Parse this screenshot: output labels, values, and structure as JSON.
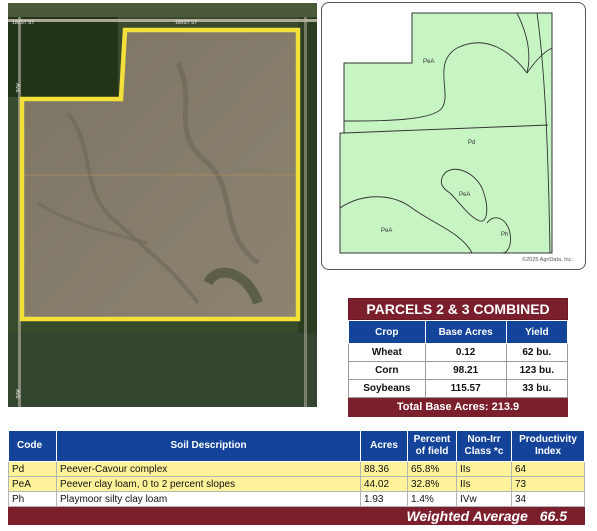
{
  "aerial": {
    "road_labels": [
      "180ST ST",
      "180ST ST",
      "AVE",
      "AVE"
    ]
  },
  "soil_map": {
    "labels": [
      "PeA",
      "Pd",
      "PeA",
      "PeA",
      "Ph"
    ],
    "copyright": "©2025 AgriData, Inc.",
    "colors": {
      "fill": "#c6f4c3",
      "line": "#333333"
    }
  },
  "parcels": {
    "title": "PARCELS 2 & 3 COMBINED",
    "headers": [
      "Crop",
      "Base Acres",
      "Yield"
    ],
    "rows": [
      [
        "Wheat",
        "0.12",
        "62 bu."
      ],
      [
        "Corn",
        "98.21",
        "123 bu."
      ],
      [
        "Soybeans",
        "115.57",
        "33 bu."
      ]
    ],
    "total_label": "Total Base Acres:",
    "total_value": "213.9"
  },
  "soils": {
    "headers": {
      "code": "Code",
      "description": "Soil Description",
      "acres": "Acres",
      "percent": "Percent of field",
      "nonirr": "Non-Irr Class *c",
      "productivity": "Productivity Index"
    },
    "rows": [
      {
        "code": "Pd",
        "description": "Peever-Cavour complex",
        "acres": "88.36",
        "percent": "65.8%",
        "nonirr": "IIs",
        "productivity": "64"
      },
      {
        "code": "PeA",
        "description": "Peever clay loam, 0 to 2 percent slopes",
        "acres": "44.02",
        "percent": "32.8%",
        "nonirr": "IIs",
        "productivity": "73"
      },
      {
        "code": "Ph",
        "description": "Playmoor silty clay loam",
        "acres": "1.93",
        "percent": "1.4%",
        "nonirr": "IVw",
        "productivity": "34"
      }
    ],
    "weighted_label": "Weighted Average",
    "weighted_value": "66.5"
  },
  "colors": {
    "maroon": "#7a1f2b",
    "blue": "#14439a",
    "highlight": "#fef29a",
    "boundary": "#f3e03a"
  }
}
